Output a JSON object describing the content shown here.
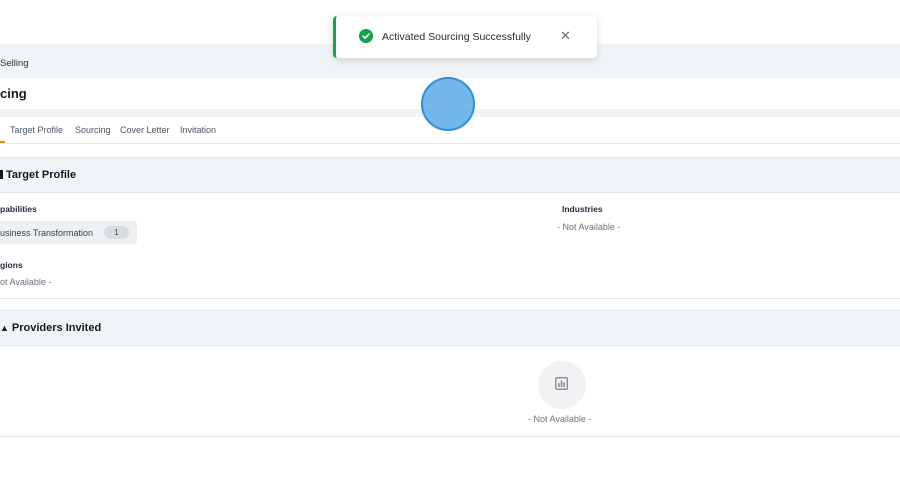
{
  "breadcrumb": {
    "text": "Selling"
  },
  "page": {
    "title": "cing"
  },
  "tabs": [
    {
      "label": "Target Profile"
    },
    {
      "label": "Sourcing"
    },
    {
      "label": "Cover Letter"
    },
    {
      "label": "Invitation"
    }
  ],
  "target_profile": {
    "title": "Target Profile",
    "capabilities_label": "pabilities",
    "capability_chip": {
      "label": "usiness Transformation",
      "count": "1"
    },
    "regions_label": "gions",
    "regions_value": "ot Available -",
    "industries_label": "Industries",
    "industries_value": "- Not Available -"
  },
  "providers": {
    "title": "Providers Invited",
    "empty_text": "- Not Available -"
  },
  "toast": {
    "message": "Activated Sourcing Successfully",
    "close": "✕"
  },
  "colors": {
    "accent": "#e08a1e",
    "success": "#16a34a",
    "band": "#f1f4f7"
  },
  "icons": [
    "check-circle-icon",
    "close-icon",
    "chart-icon",
    "users-icon"
  ]
}
